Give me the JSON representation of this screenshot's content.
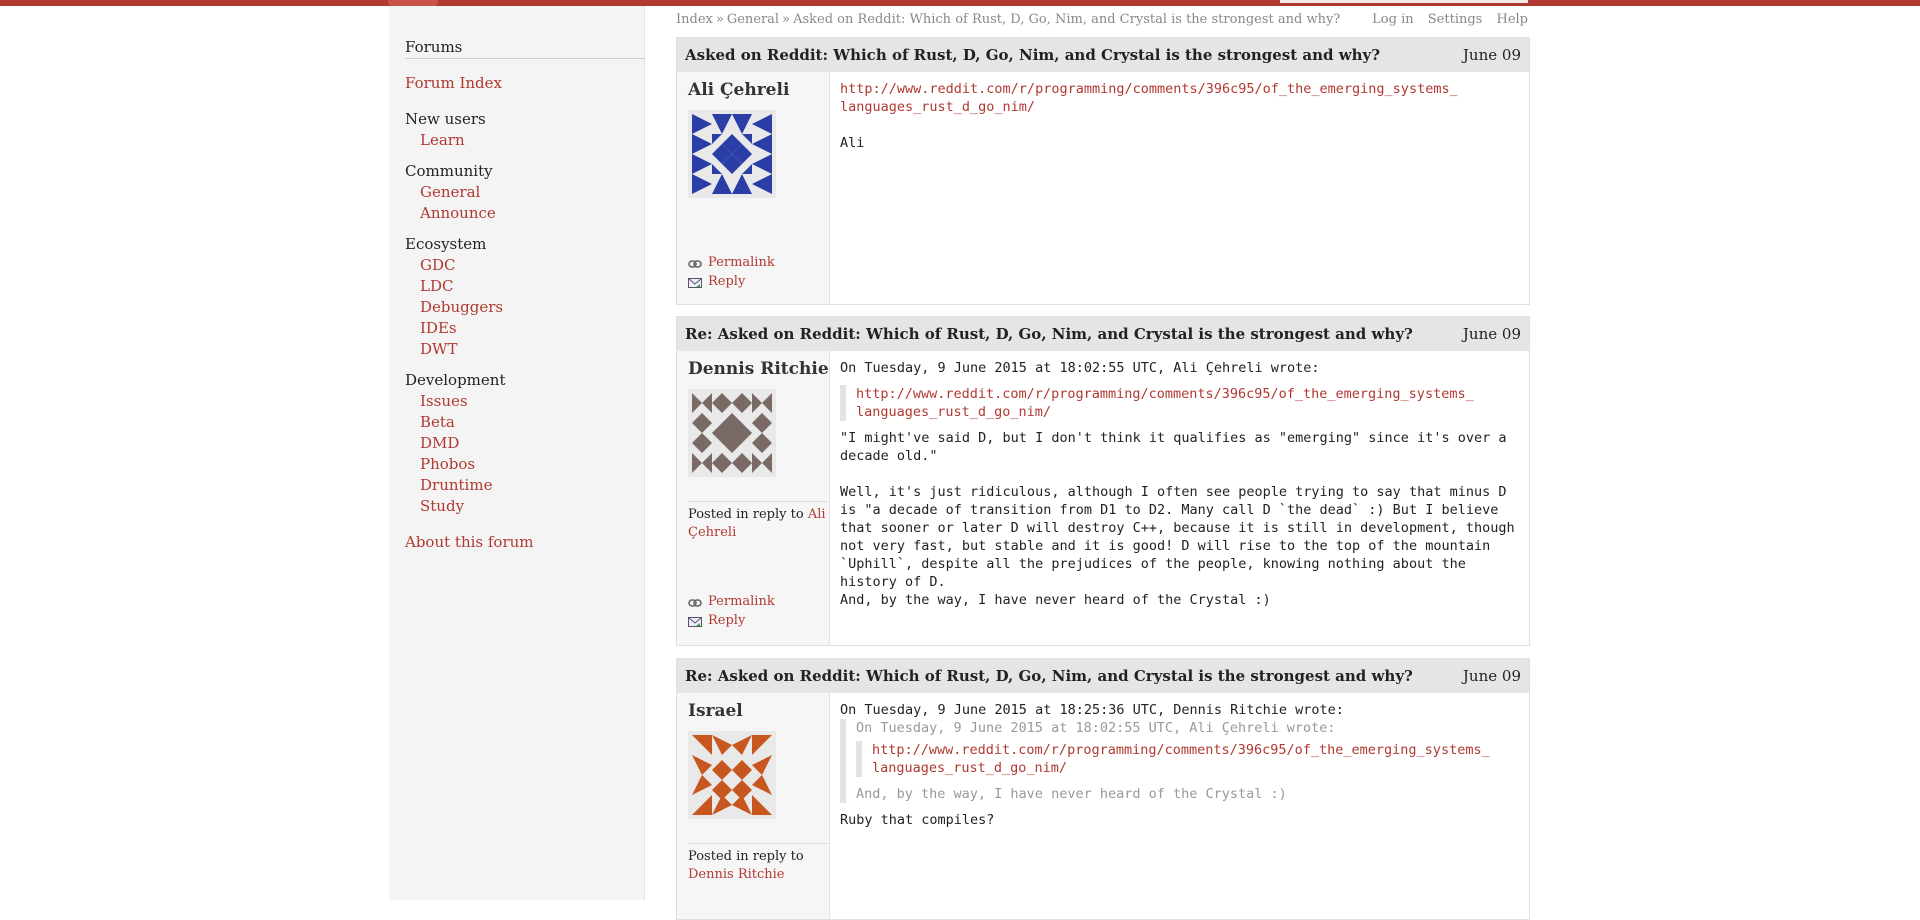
{
  "sidebar": {
    "heading": "Forums",
    "index": "Forum Index",
    "groups": [
      {
        "title": "New users",
        "items": [
          "Learn"
        ]
      },
      {
        "title": "Community",
        "items": [
          "General",
          "Announce"
        ]
      },
      {
        "title": "Ecosystem",
        "items": [
          "GDC",
          "LDC",
          "Debuggers",
          "IDEs",
          "DWT"
        ]
      },
      {
        "title": "Development",
        "items": [
          "Issues",
          "Beta",
          "DMD",
          "Phobos",
          "Druntime",
          "Study"
        ]
      }
    ],
    "about": "About this forum"
  },
  "breadcrumb": {
    "index": "Index",
    "general": "General",
    "thread": "Asked on Reddit: Which of Rust, D, Go, Nim, and Crystal is the strongest and why?",
    "sep": "»"
  },
  "toplinks": {
    "login": "Log in",
    "settings": "Settings",
    "help": "Help"
  },
  "posts": [
    {
      "title": "Asked on Reddit: Which of Rust, D, Go, Nim, and Crystal is the strongest and why?",
      "date": "June 09",
      "author": "Ali Çehreli",
      "permalink": "Permalink",
      "reply": "Reply",
      "link_line1": "http://www.reddit.com/r/programming/comments/396c95/of_the_emerging_systems_",
      "link_line2": "languages_rust_d_go_nim/",
      "signature": "Ali",
      "avatar_color": "#2b3ea8"
    },
    {
      "title": "Re: Asked on Reddit: Which of Rust, D, Go, Nim, and Crystal is the strongest and why?",
      "date": "June 09",
      "author": "Dennis Ritchie",
      "reply_prefix": "Posted in reply to",
      "reply_to": "Ali Çehreli",
      "permalink": "Permalink",
      "reply": "Reply",
      "quote_header": "On Tuesday, 9 June 2015 at 18:02:55 UTC, Ali Çehreli wrote:",
      "link_line1": "http://www.reddit.com/r/programming/comments/396c95/of_the_emerging_systems_",
      "link_line2": "languages_rust_d_go_nim/",
      "para1": "\"I might've said D, but I don't think it qualifies as \"emerging\" since it's over a decade old.\"",
      "para2": "Well, it's just ridiculous, although I often see people trying to say that minus D is \"a decade of transition from D1 to D2. Many call D `the dead` :) But I believe that sooner or later D will destroy C++, because it is still in development, though not very fast, but stable and it is good! D will rise to the top of the mountain `Uphill`, despite all the prejudices of the people, knowing nothing about the history of D.",
      "para3": "And, by the way, I have never heard of the Crystal :)",
      "avatar_color": "#7a6a66"
    },
    {
      "title": "Re: Asked on Reddit: Which of Rust, D, Go, Nim, and Crystal is the strongest and why?",
      "date": "June 09",
      "author": "Israel",
      "reply_prefix": "Posted in reply to",
      "reply_to": "Dennis Ritchie",
      "quote_header": "On Tuesday, 9 June 2015 at 18:25:36 UTC, Dennis Ritchie wrote:",
      "inner_quote_header": "On Tuesday, 9 June 2015 at 18:02:55 UTC, Ali Çehreli wrote:",
      "link_line1": "http://www.reddit.com/r/programming/comments/396c95/of_the_emerging_systems_",
      "link_line2": "languages_rust_d_go_nim/",
      "quoted_text": "And, by the way, I have never heard of the Crystal :)",
      "body": "Ruby that compiles?",
      "avatar_color": "#c8561f"
    }
  ]
}
